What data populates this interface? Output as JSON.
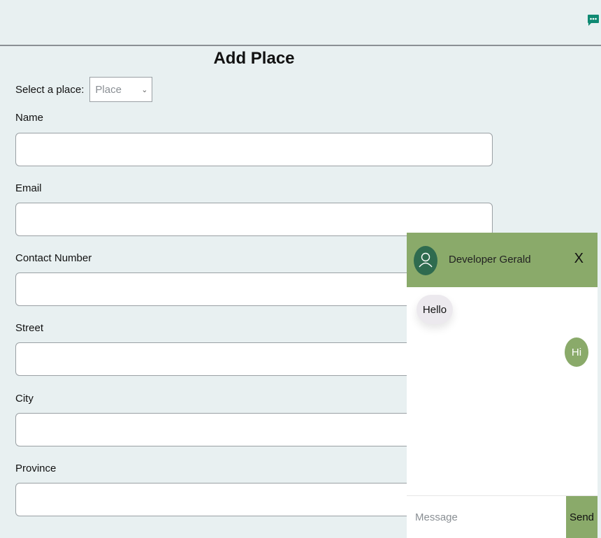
{
  "header": {
    "chat_icon": "chat-bubble-icon"
  },
  "form": {
    "title": "Add Place",
    "select_label": "Select a place:",
    "select_value": "Place",
    "fields": [
      {
        "label": "Name",
        "value": "",
        "placeholder": ""
      },
      {
        "label": "Email",
        "value": "",
        "placeholder": ""
      },
      {
        "label": "Contact Number",
        "value": "",
        "placeholder": ""
      },
      {
        "label": "Street",
        "value": "",
        "placeholder": ""
      },
      {
        "label": "City",
        "value": "",
        "placeholder": ""
      },
      {
        "label": "Province",
        "value": "",
        "placeholder": ""
      }
    ]
  },
  "chat": {
    "contact_name": "Developer Gerald",
    "close_label": "X",
    "messages": [
      {
        "from": "contact",
        "text": "Hello"
      },
      {
        "from": "me",
        "text": "Hi"
      }
    ],
    "input_placeholder": "Message",
    "send_label": "Send"
  },
  "colors": {
    "page_bg": "#e8f0f1",
    "chat_accent": "#8aaa6a",
    "avatar_bg": "#2f6b4f",
    "launcher": "#0f8a73"
  }
}
